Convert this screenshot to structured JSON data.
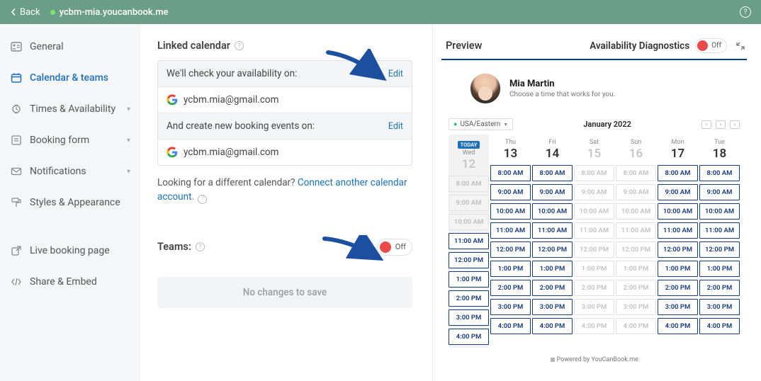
{
  "topbar": {
    "back": "Back",
    "url": "ycbm-mia.youcanbook.me"
  },
  "sidebar": {
    "items": [
      {
        "label": "General"
      },
      {
        "label": "Calendar & teams"
      },
      {
        "label": "Times & Availability"
      },
      {
        "label": "Booking form"
      },
      {
        "label": "Notifications"
      },
      {
        "label": "Styles & Appearance"
      }
    ],
    "extra": [
      {
        "label": "Live booking page"
      },
      {
        "label": "Share & Embed"
      }
    ]
  },
  "linked": {
    "title": "Linked calendar",
    "check_label": "We'll check your availability on:",
    "edit": "Edit",
    "check_email": "ycbm.mia@gmail.com",
    "create_label": "And create new booking events on:",
    "create_email": "ycbm.mia@gmail.com",
    "looking_text": "Looking for a different calendar? ",
    "connect_link": "Connect another calendar account.",
    "teams_label": "Teams:",
    "teams_toggle": "Off",
    "save_label": "No changes to save"
  },
  "preview": {
    "title": "Preview",
    "diag": "Availability Diagnostics",
    "diag_toggle": "Off",
    "name": "Mia Martin",
    "sub": "Choose a time that works for you.",
    "tz": "USA/Eastern",
    "month": "January 2022",
    "today_badge": "TODAY",
    "footer": "Powered by YouCanBook.me",
    "days": [
      {
        "dow": "Wed",
        "num": "12",
        "today": true,
        "disabled": true,
        "slots": [
          "8:00 AM",
          "9:00 AM",
          "10:00 AM",
          "11:00 AM",
          "12:00 PM",
          "1:00 PM",
          "2:00 PM",
          "3:00 PM",
          "4:00 PM"
        ]
      },
      {
        "dow": "Thu",
        "num": "13",
        "slots": [
          "8:00 AM",
          "9:00 AM",
          "10:00 AM",
          "11:00 AM",
          "12:00 PM",
          "1:00 PM",
          "2:00 PM",
          "3:00 PM",
          "4:00 PM"
        ]
      },
      {
        "dow": "Fri",
        "num": "14",
        "slots": [
          "8:00 AM",
          "9:00 AM",
          "10:00 AM",
          "11:00 AM",
          "12:00 PM",
          "1:00 PM",
          "2:00 PM",
          "3:00 PM",
          "4:00 PM"
        ]
      },
      {
        "dow": "Sat",
        "num": "15",
        "disabled": true,
        "slots": [
          "8:00 AM",
          "9:00 AM",
          "10:00 AM",
          "11:00 AM",
          "12:00 PM",
          "1:00 PM",
          "2:00 PM",
          "3:00 PM",
          "4:00 PM"
        ]
      },
      {
        "dow": "Sun",
        "num": "16",
        "disabled": true,
        "slots": [
          "8:00 AM",
          "9:00 AM",
          "10:00 AM",
          "11:00 AM",
          "12:00 PM",
          "1:00 PM",
          "2:00 PM",
          "3:00 PM",
          "4:00 PM"
        ]
      },
      {
        "dow": "Mon",
        "num": "17",
        "slots": [
          "8:00 AM",
          "9:00 AM",
          "10:00 AM",
          "11:00 AM",
          "12:00 PM",
          "1:00 PM",
          "2:00 PM",
          "3:00 PM",
          "4:00 PM"
        ]
      },
      {
        "dow": "Tue",
        "num": "18",
        "slots": [
          "8:00 AM",
          "9:00 AM",
          "10:00 AM",
          "11:00 AM",
          "12:00 PM",
          "1:00 PM",
          "2:00 PM",
          "3:00 PM",
          "4:00 PM"
        ]
      }
    ]
  }
}
